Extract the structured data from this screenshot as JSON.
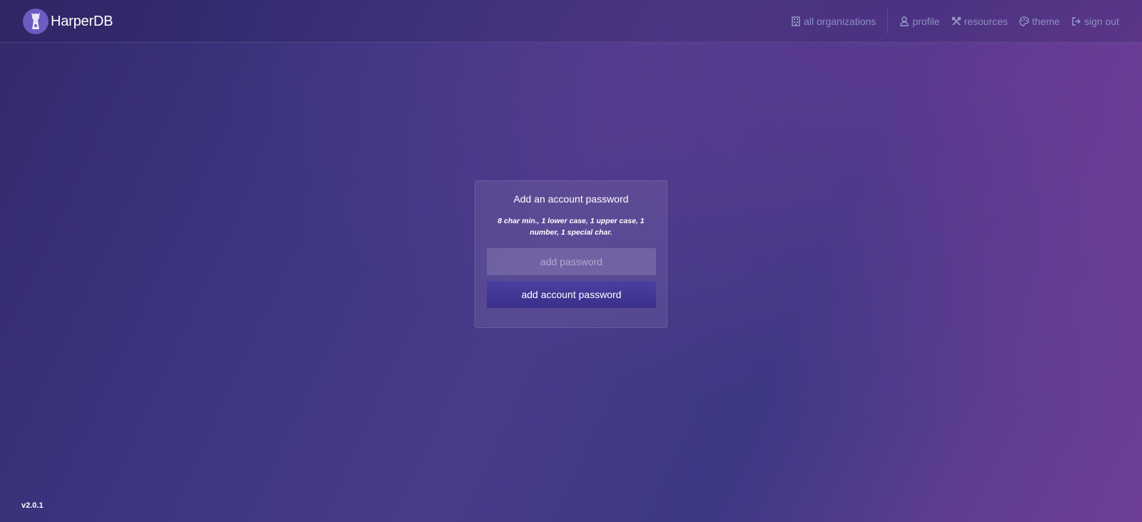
{
  "brand": {
    "name": "HarperDB"
  },
  "nav": {
    "all_organizations": "all organizations",
    "profile": "profile",
    "resources": "resources",
    "theme": "theme",
    "sign_out": "sign out"
  },
  "icons": {
    "brand": "harperdb-dog-logo-icon",
    "all_organizations": "building-icon",
    "profile": "user-icon",
    "resources": "tools-icon",
    "theme": "palette-icon",
    "sign_out": "sign-out-icon"
  },
  "card": {
    "title": "Add an account password",
    "hint": "8 char min., 1 lower case, 1 upper case, 1 number, 1 special char.",
    "password_placeholder": "add password",
    "password_value": "",
    "submit_label": "add account password"
  },
  "footer": {
    "version": "v2.0.1"
  },
  "colors": {
    "background_start": "#33296b",
    "background_mid": "#3d3682",
    "background_end": "#6e3f96",
    "nav_text": "#96a0cd",
    "button_bg": "#3f3594"
  }
}
